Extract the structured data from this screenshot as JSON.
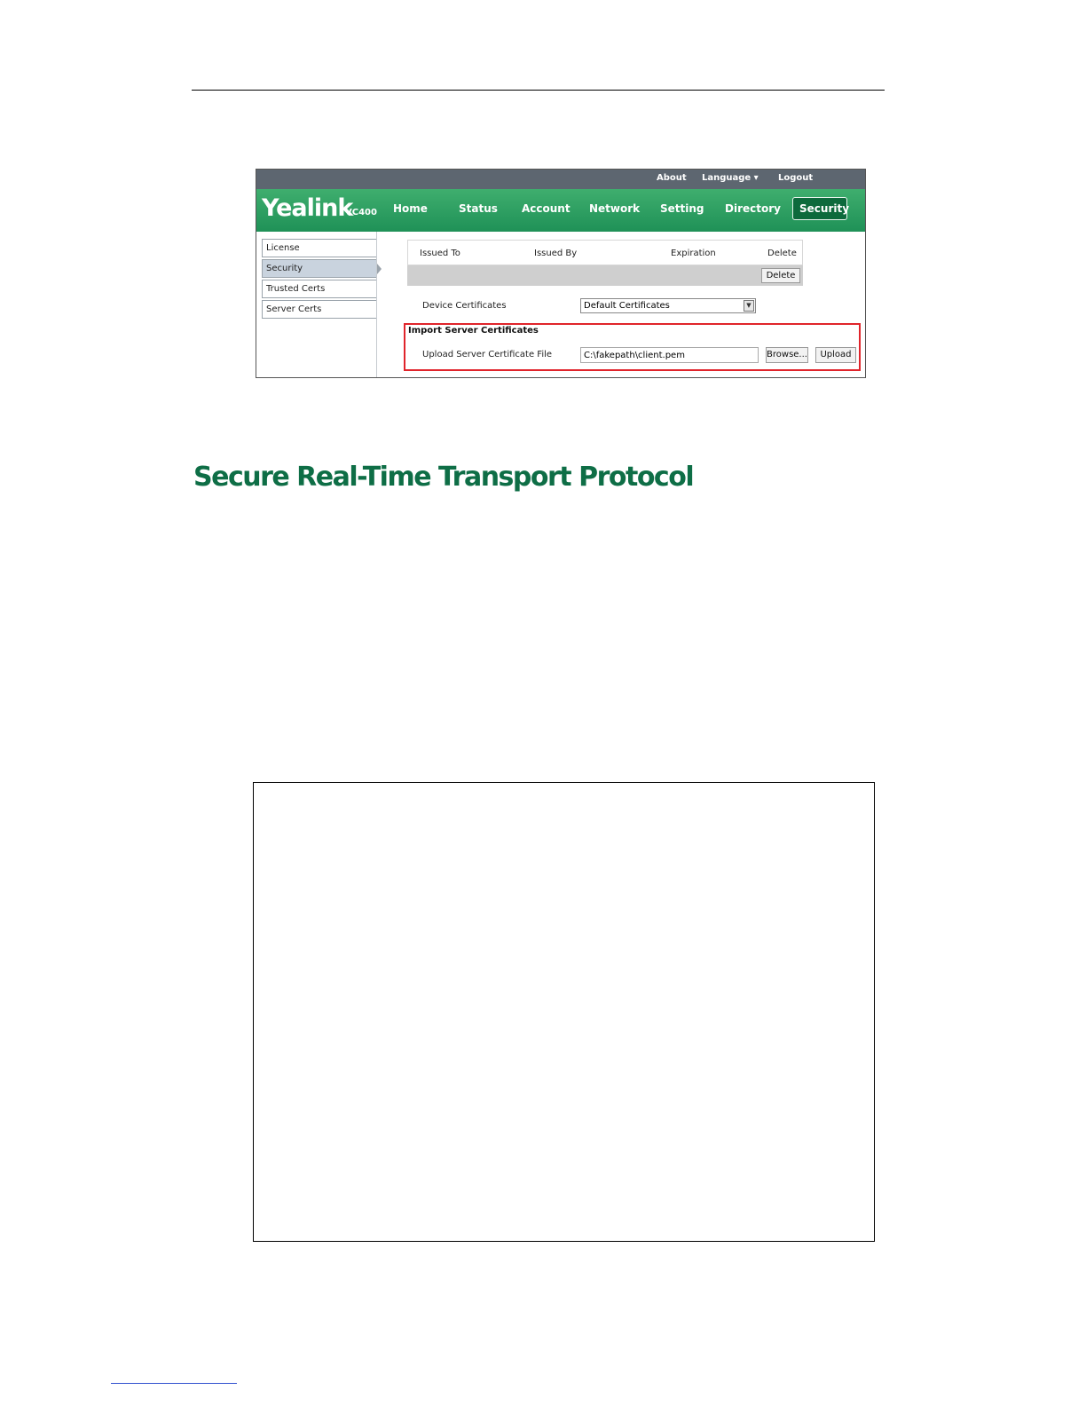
{
  "topbar": {
    "about": "About",
    "language": "Language ▾",
    "logout": "Logout"
  },
  "brand": {
    "name": "Yealink",
    "model": "VC400"
  },
  "nav": {
    "items": [
      {
        "label": "Home"
      },
      {
        "label": "Status"
      },
      {
        "label": "Account"
      },
      {
        "label": "Network"
      },
      {
        "label": "Setting"
      },
      {
        "label": "Directory"
      },
      {
        "label": "Security"
      }
    ],
    "active": "Security"
  },
  "sidebar": {
    "items": [
      {
        "label": "License"
      },
      {
        "label": "Security"
      },
      {
        "label": "Trusted Certs"
      },
      {
        "label": "Server Certs"
      }
    ],
    "active": "Security"
  },
  "cert_table": {
    "headers": [
      "Issued To",
      "Issued By",
      "Expiration",
      "Delete"
    ],
    "delete_button": "Delete"
  },
  "device_certificates": {
    "label": "Device Certificates",
    "value": "Default Certificates"
  },
  "import_section": {
    "title": "Import Server Certificates",
    "upload_label": "Upload Server Certificate File",
    "file_value": "C:\\fakepath\\client.pem",
    "browse_button": "Browse...",
    "upload_button": "Upload"
  },
  "document": {
    "heading": "Secure Real-Time Transport Protocol"
  },
  "colors": {
    "brand_green": "#1f9157",
    "heading_green": "#0e6e46",
    "highlight_red": "#e0242b"
  }
}
